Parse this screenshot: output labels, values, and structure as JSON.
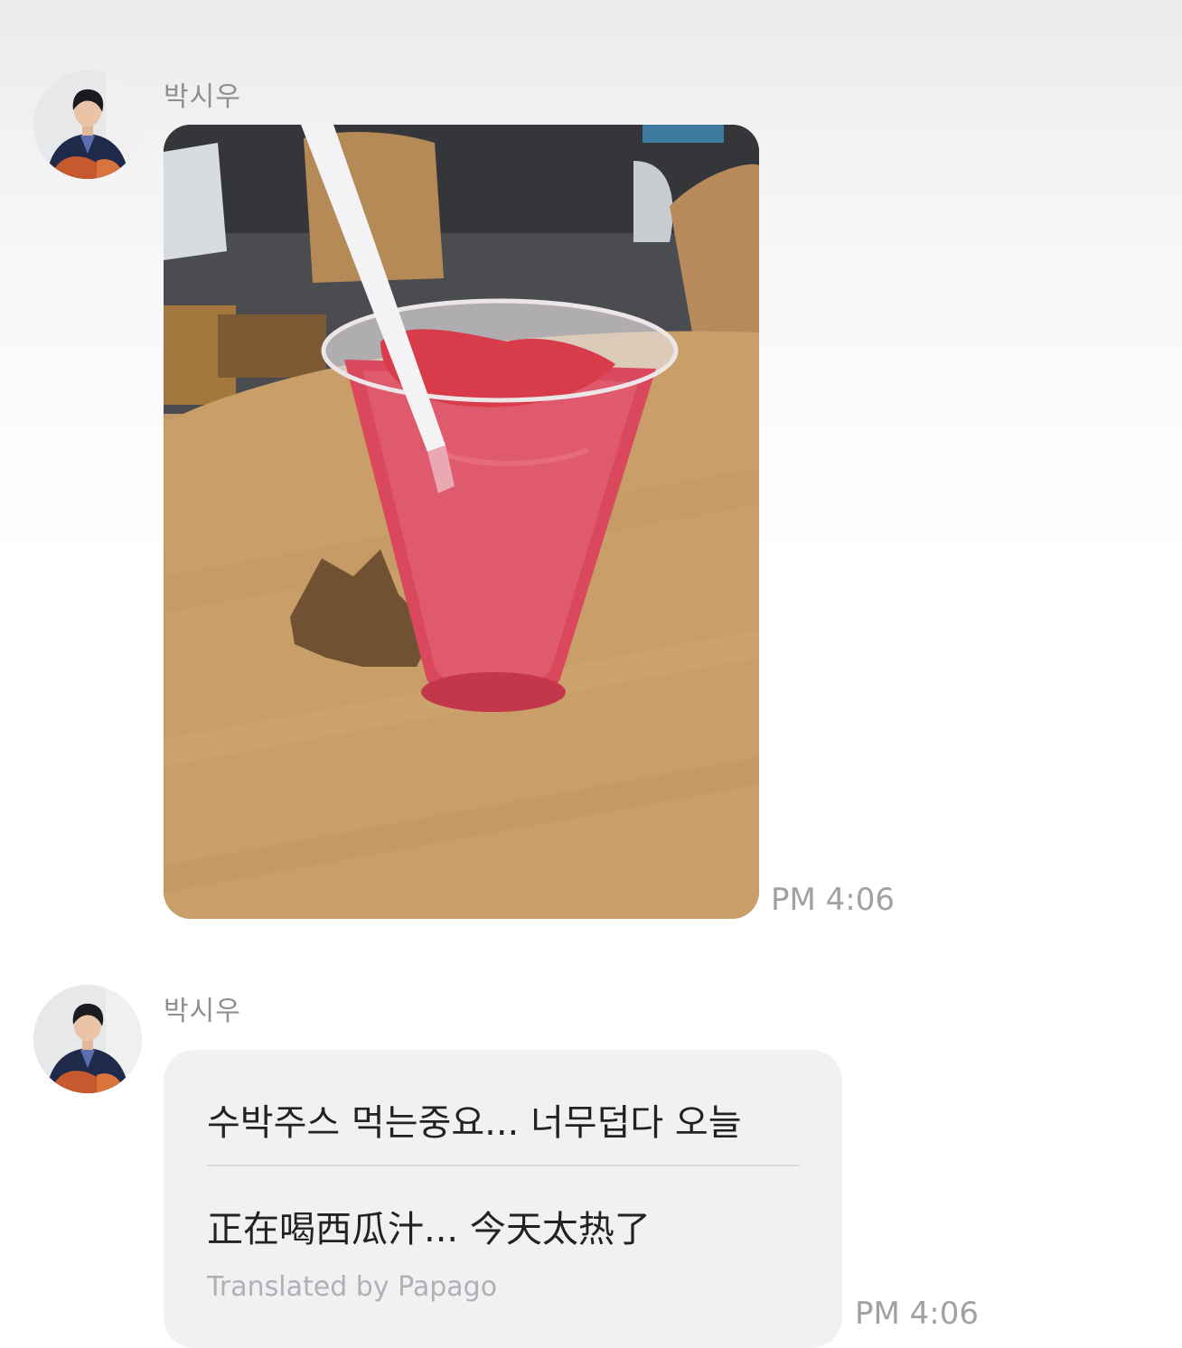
{
  "messages": [
    {
      "sender": "박시우",
      "type": "photo",
      "photo_subject": "watermelon juice in a glass with a straw on a wooden cafe table",
      "time": "PM 4:06"
    },
    {
      "sender": "박시우",
      "type": "text",
      "original": "수박주스 먹는중요... 너무덥다 오늘",
      "translated": "正在喝西瓜汁... 今天太热了",
      "translation_credit": "Translated by Papago",
      "time": "PM 4:06"
    }
  ],
  "icons": {
    "avatar": "profile-photo-icon"
  }
}
